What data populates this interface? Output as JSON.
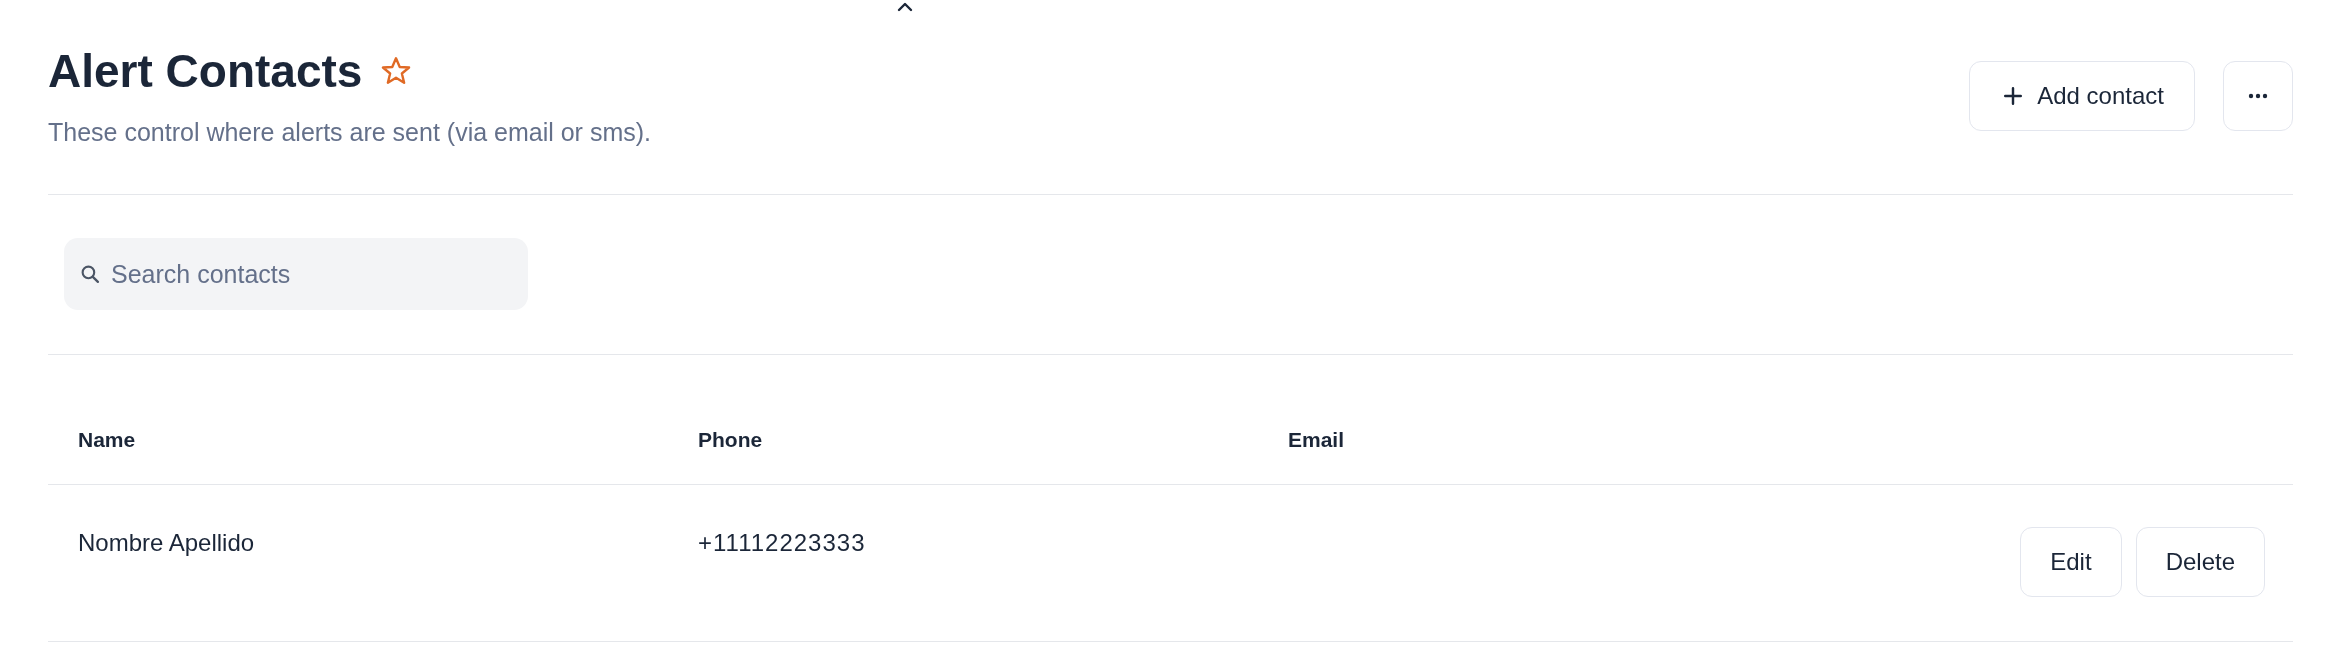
{
  "header": {
    "title": "Alert Contacts",
    "starred": false,
    "subtitle": "These control where alerts are sent (via email or sms).",
    "add_button": "Add contact"
  },
  "search": {
    "placeholder": "Search contacts"
  },
  "table": {
    "columns": [
      "Name",
      "Phone",
      "Email"
    ],
    "rows": [
      {
        "name": "Nombre Apellido",
        "phone": "+11112223333",
        "actions": [
          "Edit",
          "Delete"
        ]
      }
    ]
  }
}
